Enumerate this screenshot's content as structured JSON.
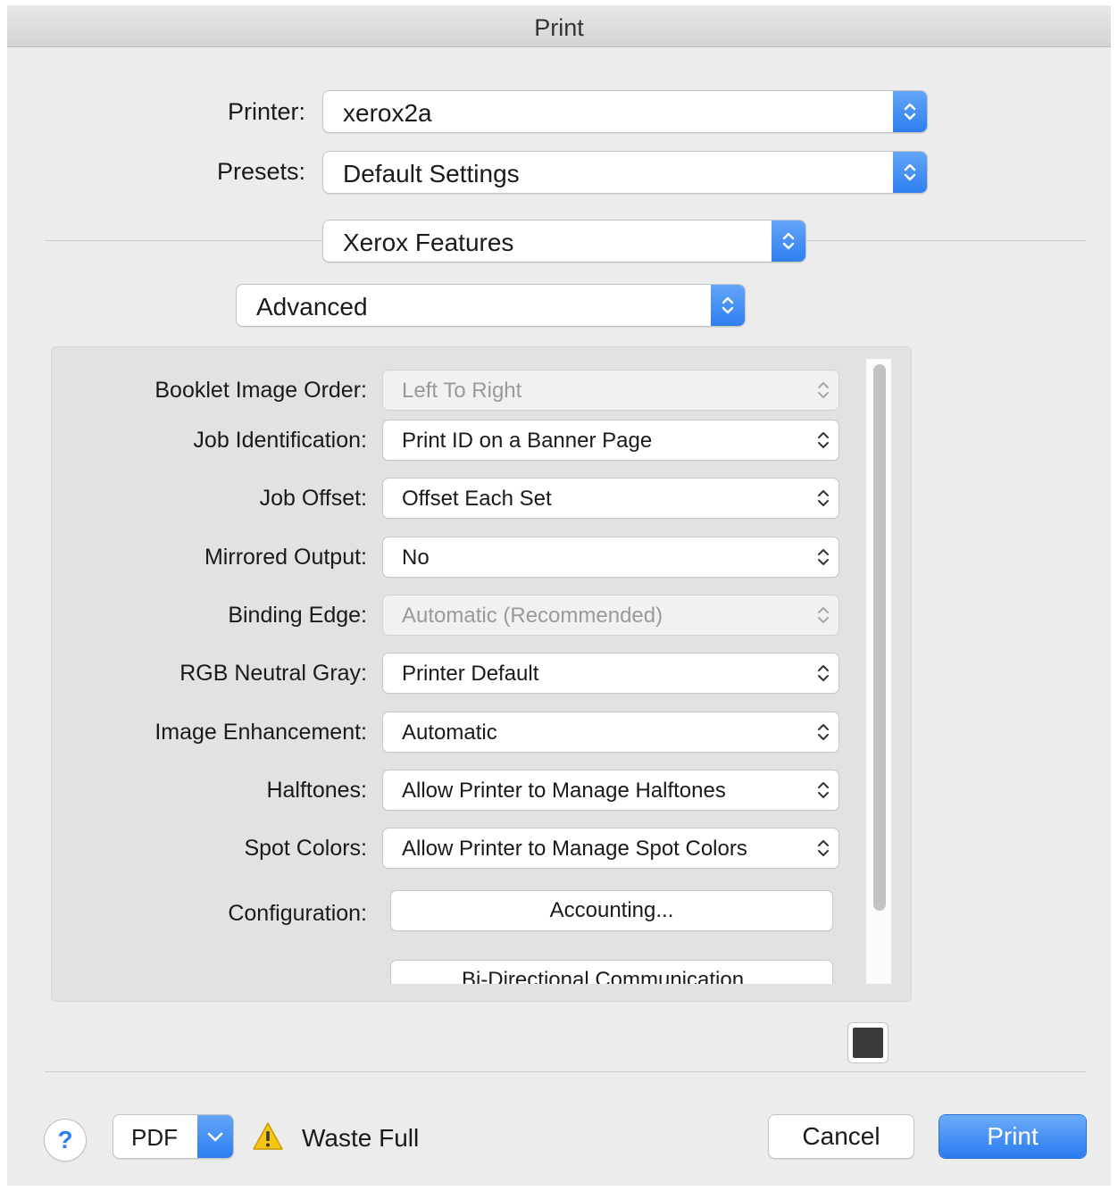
{
  "window": {
    "title": "Print"
  },
  "printer": {
    "label": "Printer:",
    "value": "xerox2a"
  },
  "presets": {
    "label": "Presets:",
    "value": "Default Settings"
  },
  "section_popup": {
    "value": "Xerox Features"
  },
  "subsection_popup": {
    "value": "Advanced"
  },
  "features": [
    {
      "label": "Booklet Image Order:",
      "value": "Left To Right",
      "disabled": true
    },
    {
      "label": "Job Identification:",
      "value": "Print ID on a Banner Page",
      "disabled": false
    },
    {
      "label": "Job Offset:",
      "value": "Offset Each Set",
      "disabled": false
    },
    {
      "label": "Mirrored Output:",
      "value": "No",
      "disabled": false
    },
    {
      "label": "Binding Edge:",
      "value": "Automatic (Recommended)",
      "disabled": true
    },
    {
      "label": "RGB Neutral Gray:",
      "value": "Printer Default",
      "disabled": false
    },
    {
      "label": "Image Enhancement:",
      "value": "Automatic",
      "disabled": false
    },
    {
      "label": "Halftones:",
      "value": "Allow Printer to Manage Halftones",
      "disabled": false
    },
    {
      "label": "Spot Colors:",
      "value": "Allow Printer to Manage Spot Colors",
      "disabled": false
    }
  ],
  "configuration": {
    "label": "Configuration:",
    "buttons": [
      "Accounting...",
      "Bi-Directional Communication..."
    ]
  },
  "footer": {
    "help": "?",
    "pdf": "PDF",
    "status": "Waste Full",
    "cancel": "Cancel",
    "print": "Print"
  },
  "colors": {
    "accent": "#2e7ff1",
    "swatch": "#3a3a3a"
  }
}
